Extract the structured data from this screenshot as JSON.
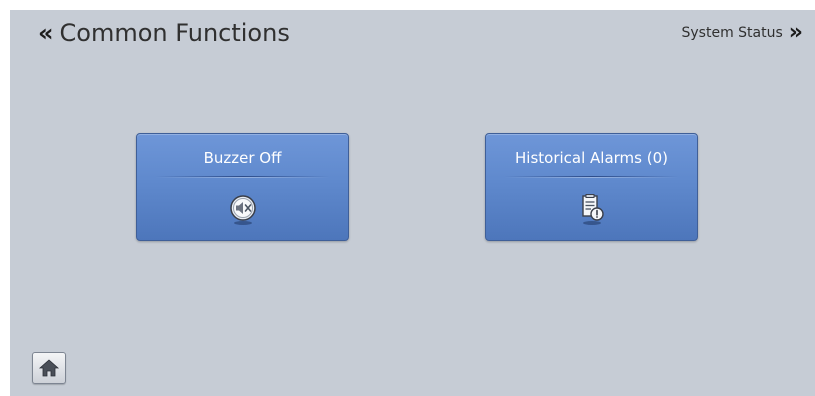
{
  "header": {
    "title": "Common Functions",
    "next_label": "System Status",
    "back_icon": "double-chevron-left-icon",
    "next_icon": "double-chevron-right-icon"
  },
  "functions": [
    {
      "label": "Buzzer Off",
      "icon": "speaker-mute-icon"
    },
    {
      "label": "Historical Alarms (0)",
      "icon": "alarm-log-icon"
    }
  ],
  "footer": {
    "home_icon": "home-icon"
  },
  "colors": {
    "screen_bg": "#c6ccd5",
    "button_blue": "#5f89cd",
    "button_border": "#3f5f98",
    "text_dark": "#303030",
    "text_light": "#ffffff"
  }
}
